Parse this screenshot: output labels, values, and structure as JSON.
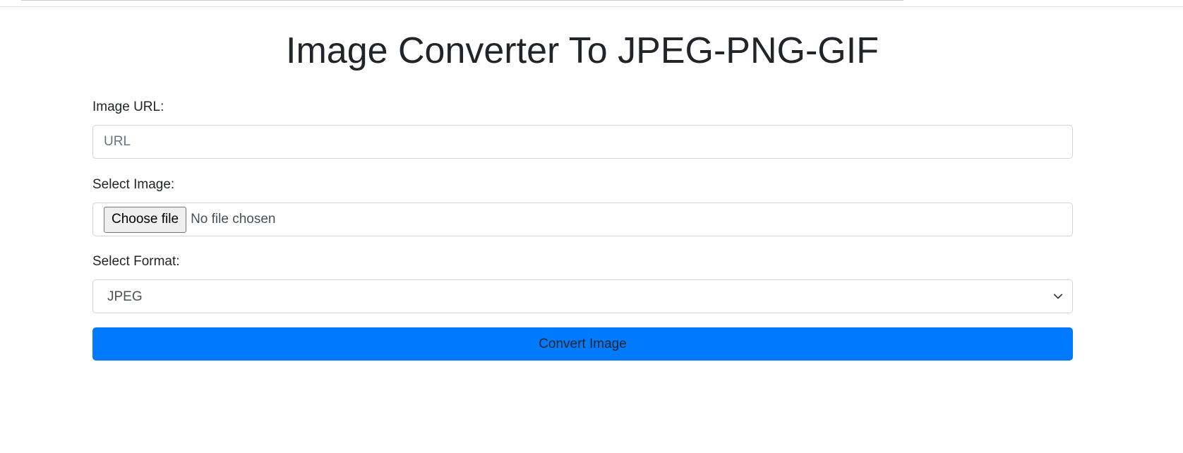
{
  "page": {
    "title": "Image Converter To JPEG-PNG-GIF"
  },
  "form": {
    "url_label": "Image URL:",
    "url_placeholder": "URL",
    "url_value": "",
    "image_label": "Select Image:",
    "file_button_label": "Choose file",
    "file_status": "No file chosen",
    "format_label": "Select Format:",
    "format_selected": "JPEG",
    "submit_label": "Convert Image"
  },
  "icons": {
    "select_arrow": "chevron-down-icon"
  },
  "colors": {
    "primary": "#007bff",
    "border": "#ced4da",
    "text": "#212529"
  }
}
